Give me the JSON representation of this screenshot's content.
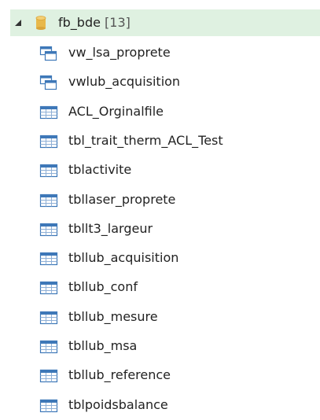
{
  "database": {
    "name": "fb_bde",
    "count": "[13]"
  },
  "items": [
    {
      "label": "vw_lsa_proprete",
      "icon": "view-icon"
    },
    {
      "label": "vwlub_acquisition",
      "icon": "view-icon"
    },
    {
      "label": "ACL_Orginalfile",
      "icon": "table-icon"
    },
    {
      "label": "tbl_trait_therm_ACL_Test",
      "icon": "table-icon"
    },
    {
      "label": "tblactivite",
      "icon": "table-icon"
    },
    {
      "label": "tbllaser_proprete",
      "icon": "table-icon"
    },
    {
      "label": "tbllt3_largeur",
      "icon": "table-icon"
    },
    {
      "label": "tbllub_acquisition",
      "icon": "table-icon"
    },
    {
      "label": "tbllub_conf",
      "icon": "table-icon"
    },
    {
      "label": "tbllub_mesure",
      "icon": "table-icon"
    },
    {
      "label": "tbllub_msa",
      "icon": "table-icon"
    },
    {
      "label": "tbllub_reference",
      "icon": "table-icon"
    },
    {
      "label": "tblpoidsbalance",
      "icon": "table-icon"
    }
  ],
  "colors": {
    "selected_bg": "#dff1e1",
    "icon_blue": "#3e78b8",
    "db_gold": "#e8b84a"
  }
}
